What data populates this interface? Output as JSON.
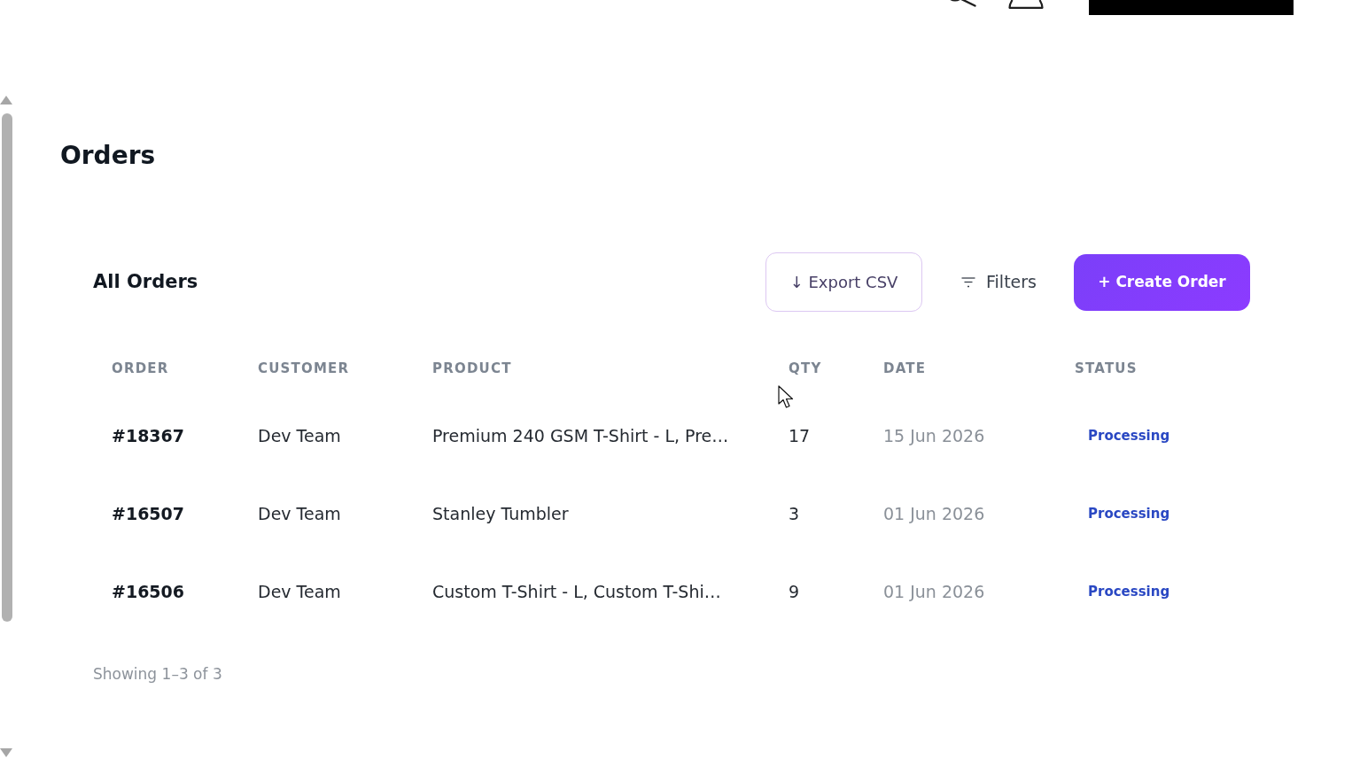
{
  "page": {
    "title": "Orders"
  },
  "orders_panel": {
    "title": "All Orders",
    "actions": [
      {
        "kind": "outline",
        "label": "↓ Export CSV"
      },
      {
        "kind": "ghost",
        "label": "Filters"
      },
      {
        "kind": "primary",
        "label": "+ Create Order"
      }
    ]
  },
  "table": {
    "columns": [
      "ORDER",
      "CUSTOMER",
      "PRODUCT",
      "QTY",
      "DATE",
      "STATUS"
    ],
    "rows": [
      {
        "order": "#18367",
        "customer": "Dev Team",
        "product": "Premium 240 GSM T-Shirt - L, Pre…",
        "qty": "17",
        "date": "15 Jun 2026",
        "status": "Processing"
      },
      {
        "order": "#16507",
        "customer": "Dev Team",
        "product": "Stanley Tumbler",
        "qty": "3",
        "date": "01 Jun 2026",
        "status": "Processing"
      },
      {
        "order": "#16506",
        "customer": "Dev Team",
        "product": "Custom T-Shirt - L, Custom T-Shi…",
        "qty": "9",
        "date": "01 Jun 2026",
        "status": "Processing"
      }
    ]
  },
  "summary": "Showing 1–3 of 3"
}
